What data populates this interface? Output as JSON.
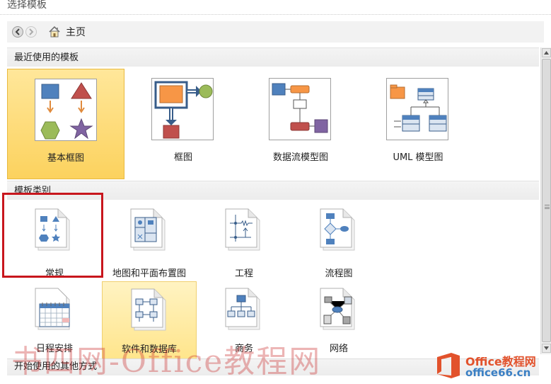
{
  "window": {
    "title": "选择模板"
  },
  "nav": {
    "home_label": "主页"
  },
  "sections": {
    "recent": "最近使用的模板",
    "categories": "模板类别",
    "other": "开始使用的其他方式"
  },
  "recent_templates": [
    {
      "label": "基本框图",
      "selected": true
    },
    {
      "label": "框图"
    },
    {
      "label": "数据流模型图"
    },
    {
      "label": "UML 模型图"
    }
  ],
  "categories": [
    {
      "label": "常规"
    },
    {
      "label": "地图和平面布置图"
    },
    {
      "label": "工程"
    },
    {
      "label": "流程图"
    },
    {
      "label": "日程安排"
    },
    {
      "label": "软件和数据库",
      "hovered": true
    },
    {
      "label": "商务"
    },
    {
      "label": "网络"
    }
  ],
  "watermark": {
    "text": "书四网-Office教程网"
  },
  "logo": {
    "line1": "Office教程网",
    "line2": "office66.cn"
  },
  "colors": {
    "selected_bg": "#fcd25e",
    "highlight_border": "#c8161d",
    "shape_blue": "#4f81bd",
    "shape_red": "#c0504d",
    "shape_green": "#9bbb59",
    "shape_purple": "#8064a2",
    "shape_orange": "#f79646"
  }
}
